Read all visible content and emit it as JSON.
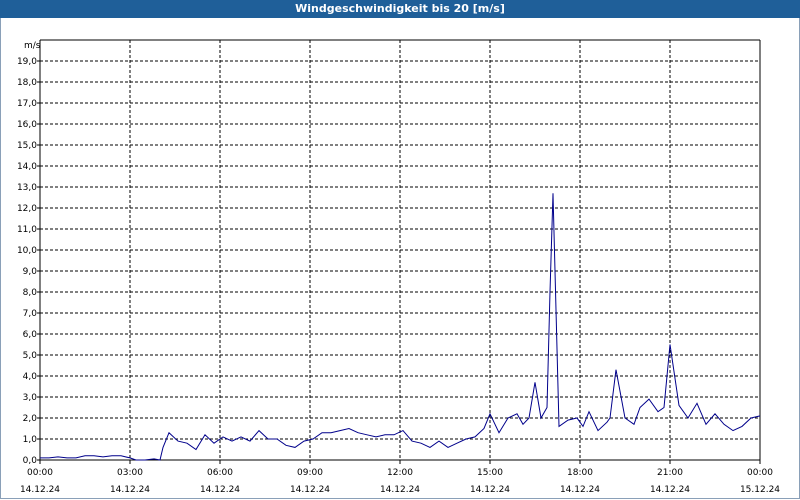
{
  "window": {
    "title": "Windgeschwindigkeit bis 20 [m/s]"
  },
  "chart_data": {
    "type": "line",
    "title": "Windgeschwindigkeit bis 20 [m/s]",
    "ylabel": "m/s",
    "ylim": [
      0,
      20
    ],
    "y_ticks": [
      "0,0",
      "1,0",
      "2,0",
      "3,0",
      "4,0",
      "5,0",
      "6,0",
      "7,0",
      "8,0",
      "9,0",
      "10,0",
      "11,0",
      "12,0",
      "13,0",
      "14,0",
      "15,0",
      "16,0",
      "17,0",
      "18,0",
      "19,0"
    ],
    "x_range_hours": [
      0,
      24
    ],
    "x_ticks": [
      {
        "time": "00:00",
        "date": "14.12.24"
      },
      {
        "time": "03:00",
        "date": "14.12.24"
      },
      {
        "time": "06:00",
        "date": "14.12.24"
      },
      {
        "time": "09:00",
        "date": "14.12.24"
      },
      {
        "time": "12:00",
        "date": "14.12.24"
      },
      {
        "time": "15:00",
        "date": "14.12.24"
      },
      {
        "time": "18:00",
        "date": "14.12.24"
      },
      {
        "time": "21:00",
        "date": "14.12.24"
      },
      {
        "time": "00:00",
        "date": "15.12.24"
      }
    ],
    "grid": true,
    "series_color": "#00008b",
    "x": [
      0.0,
      0.3,
      0.6,
      0.9,
      1.2,
      1.5,
      1.8,
      2.1,
      2.4,
      2.7,
      3.0,
      3.2,
      3.5,
      3.8,
      4.0,
      4.1,
      4.3,
      4.6,
      4.9,
      5.2,
      5.5,
      5.8,
      6.1,
      6.4,
      6.7,
      7.0,
      7.3,
      7.6,
      7.9,
      8.2,
      8.5,
      8.8,
      9.1,
      9.4,
      9.7,
      10.0,
      10.3,
      10.6,
      10.9,
      11.2,
      11.5,
      11.8,
      12.1,
      12.4,
      12.7,
      13.0,
      13.3,
      13.6,
      13.9,
      14.2,
      14.5,
      14.8,
      15.0,
      15.3,
      15.6,
      15.9,
      16.1,
      16.3,
      16.5,
      16.7,
      16.9,
      17.0,
      17.1,
      17.3,
      17.6,
      17.9,
      18.1,
      18.3,
      18.6,
      18.9,
      19.0,
      19.2,
      19.5,
      19.8,
      20.0,
      20.3,
      20.6,
      20.8,
      21.0,
      21.3,
      21.6,
      21.9,
      22.2,
      22.5,
      22.8,
      23.1,
      23.4,
      23.7,
      24.0
    ],
    "y": [
      0.1,
      0.1,
      0.15,
      0.1,
      0.1,
      0.2,
      0.2,
      0.15,
      0.2,
      0.2,
      0.1,
      0.0,
      0.0,
      0.05,
      0.0,
      0.6,
      1.3,
      0.9,
      0.8,
      0.5,
      1.2,
      0.8,
      1.1,
      0.9,
      1.1,
      0.9,
      1.4,
      1.0,
      1.0,
      0.7,
      0.6,
      0.9,
      1.0,
      1.3,
      1.3,
      1.4,
      1.5,
      1.3,
      1.2,
      1.1,
      1.2,
      1.2,
      1.4,
      0.9,
      0.8,
      0.6,
      0.9,
      0.6,
      0.8,
      1.0,
      1.1,
      1.5,
      2.2,
      1.3,
      2.0,
      2.2,
      1.7,
      2.0,
      3.7,
      2.0,
      2.5,
      8.0,
      12.7,
      1.6,
      1.9,
      2.0,
      1.6,
      2.3,
      1.4,
      1.8,
      2.0,
      4.3,
      2.0,
      1.7,
      2.5,
      2.9,
      2.3,
      2.5,
      5.5,
      2.6,
      2.0,
      2.7,
      1.7,
      2.2,
      1.7,
      1.4,
      1.6,
      2.0,
      2.1
    ]
  }
}
